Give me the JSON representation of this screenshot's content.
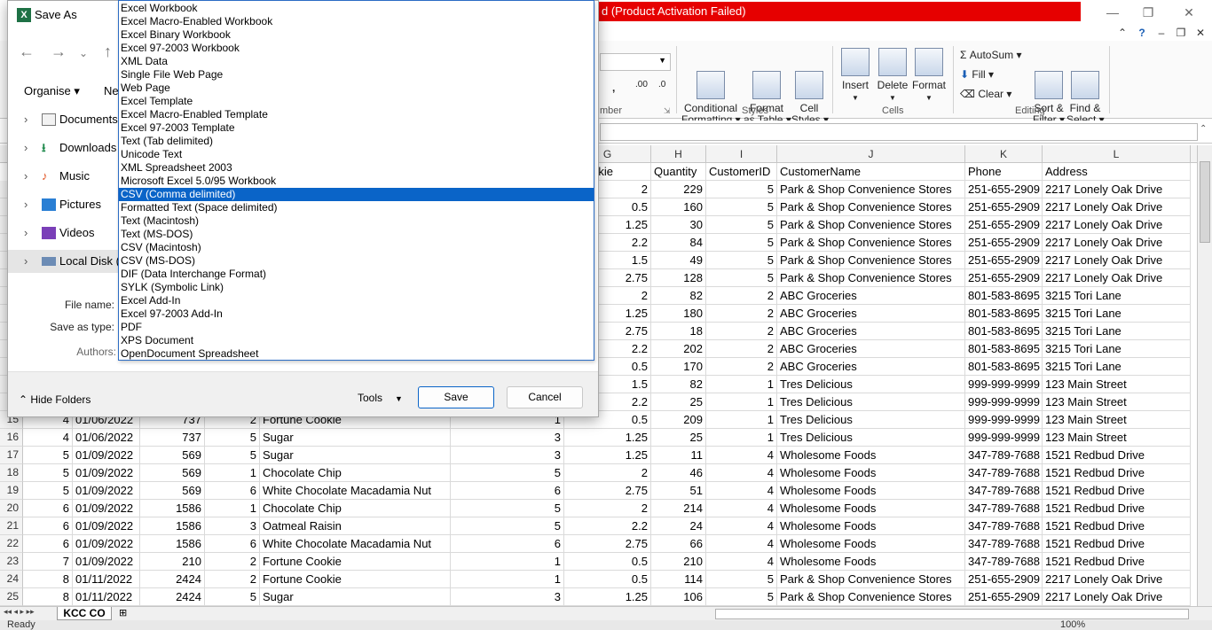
{
  "excel": {
    "activation_text": "d (Product Activation Failed)",
    "ribbon": {
      "conditional_formatting": "Conditional\nFormatting ▾",
      "format_as_table": "Format\nas Table ▾",
      "cell_styles": "Cell\nStyles ▾",
      "styles_label": "Styles",
      "insert": "Insert",
      "delete": "Delete",
      "format": "Format",
      "cells_label": "Cells",
      "autosum": "AutoSum ▾",
      "fill": "Fill ▾",
      "clear": "Clear ▾",
      "sort_filter": "Sort &\nFilter ▾",
      "find_select": "Find &\nSelect ▾",
      "editing_label": "Editing",
      "number_label": "mber",
      "number_dec_inc": ".00",
      "number_dec_dec": ".0"
    },
    "column_letters": [
      "G",
      "H",
      "I",
      "J",
      "K",
      "L"
    ],
    "header_row": {
      "g": "erCookie",
      "h": "Quantity",
      "i": "CustomerID",
      "j": "CustomerName",
      "k": "Phone",
      "l": "Address"
    },
    "rows": [
      {
        "n": "",
        "a": "",
        "b": "",
        "c": "",
        "d": "",
        "e": "",
        "f": "",
        "g": "2",
        "h": "229",
        "i": "5",
        "j": "Park & Shop Convenience Stores",
        "k": "251-655-2909",
        "l": "2217 Lonely Oak Drive"
      },
      {
        "n": "",
        "a": "",
        "b": "",
        "c": "",
        "d": "",
        "e": "",
        "f": "",
        "g": "0.5",
        "h": "160",
        "i": "5",
        "j": "Park & Shop Convenience Stores",
        "k": "251-655-2909",
        "l": "2217 Lonely Oak Drive"
      },
      {
        "n": "",
        "a": "",
        "b": "",
        "c": "",
        "d": "",
        "e": "",
        "f": "",
        "g": "1.25",
        "h": "30",
        "i": "5",
        "j": "Park & Shop Convenience Stores",
        "k": "251-655-2909",
        "l": "2217 Lonely Oak Drive"
      },
      {
        "n": "",
        "a": "",
        "b": "",
        "c": "",
        "d": "",
        "e": "",
        "f": "",
        "g": "2.2",
        "h": "84",
        "i": "5",
        "j": "Park & Shop Convenience Stores",
        "k": "251-655-2909",
        "l": "2217 Lonely Oak Drive"
      },
      {
        "n": "",
        "a": "",
        "b": "",
        "c": "",
        "d": "",
        "e": "",
        "f": "",
        "g": "1.5",
        "h": "49",
        "i": "5",
        "j": "Park & Shop Convenience Stores",
        "k": "251-655-2909",
        "l": "2217 Lonely Oak Drive"
      },
      {
        "n": "",
        "a": "",
        "b": "",
        "c": "",
        "d": "",
        "e": "",
        "f": "",
        "g": "2.75",
        "h": "128",
        "i": "5",
        "j": "Park & Shop Convenience Stores",
        "k": "251-655-2909",
        "l": "2217 Lonely Oak Drive"
      },
      {
        "n": "",
        "a": "",
        "b": "",
        "c": "",
        "d": "",
        "e": "",
        "f": "",
        "g": "2",
        "h": "82",
        "i": "2",
        "j": "ABC Groceries",
        "k": "801-583-8695",
        "l": "3215 Tori Lane"
      },
      {
        "n": "",
        "a": "",
        "b": "",
        "c": "",
        "d": "",
        "e": "",
        "f": "",
        "g": "1.25",
        "h": "180",
        "i": "2",
        "j": "ABC Groceries",
        "k": "801-583-8695",
        "l": "3215 Tori Lane"
      },
      {
        "n": "",
        "a": "",
        "b": "",
        "c": "",
        "d": "",
        "e": "",
        "f": "",
        "g": "2.75",
        "h": "18",
        "i": "2",
        "j": "ABC Groceries",
        "k": "801-583-8695",
        "l": "3215 Tori Lane"
      },
      {
        "n": "",
        "a": "",
        "b": "",
        "c": "",
        "d": "",
        "e": "",
        "f": "",
        "g": "2.2",
        "h": "202",
        "i": "2",
        "j": "ABC Groceries",
        "k": "801-583-8695",
        "l": "3215 Tori Lane"
      },
      {
        "n": "",
        "a": "",
        "b": "",
        "c": "",
        "d": "",
        "e": "",
        "f": "",
        "g": "0.5",
        "h": "170",
        "i": "2",
        "j": "ABC Groceries",
        "k": "801-583-8695",
        "l": "3215 Tori Lane"
      },
      {
        "n": "",
        "a": "",
        "b": "",
        "c": "",
        "d": "",
        "e": "",
        "f": "",
        "g": "1.5",
        "h": "82",
        "i": "1",
        "j": "Tres Delicious",
        "k": "999-999-9999",
        "l": "123 Main Street"
      },
      {
        "n": "",
        "a": "",
        "b": "",
        "c": "",
        "d": "",
        "e": "",
        "f": "",
        "g": "2.2",
        "h": "25",
        "i": "1",
        "j": "Tres Delicious",
        "k": "999-999-9999",
        "l": "123 Main Street"
      },
      {
        "n": "15",
        "a": "4",
        "b": "01/06/2022",
        "c": "737",
        "d": "2",
        "e": "Fortune Cookie",
        "f": "1",
        "g": "0.5",
        "h": "209",
        "i": "1",
        "j": "Tres Delicious",
        "k": "999-999-9999",
        "l": "123 Main Street"
      },
      {
        "n": "16",
        "a": "4",
        "b": "01/06/2022",
        "c": "737",
        "d": "5",
        "e": "Sugar",
        "f": "3",
        "g": "1.25",
        "h": "25",
        "i": "1",
        "j": "Tres Delicious",
        "k": "999-999-9999",
        "l": "123 Main Street"
      },
      {
        "n": "17",
        "a": "5",
        "b": "01/09/2022",
        "c": "569",
        "d": "5",
        "e": "Sugar",
        "f": "3",
        "g": "1.25",
        "h": "11",
        "i": "4",
        "j": "Wholesome Foods",
        "k": "347-789-7688",
        "l": "1521 Redbud Drive"
      },
      {
        "n": "18",
        "a": "5",
        "b": "01/09/2022",
        "c": "569",
        "d": "1",
        "e": "Chocolate Chip",
        "f": "5",
        "g": "2",
        "h": "46",
        "i": "4",
        "j": "Wholesome Foods",
        "k": "347-789-7688",
        "l": "1521 Redbud Drive"
      },
      {
        "n": "19",
        "a": "5",
        "b": "01/09/2022",
        "c": "569",
        "d": "6",
        "e": "White Chocolate Macadamia Nut",
        "f": "6",
        "g": "2.75",
        "h": "51",
        "i": "4",
        "j": "Wholesome Foods",
        "k": "347-789-7688",
        "l": "1521 Redbud Drive"
      },
      {
        "n": "20",
        "a": "6",
        "b": "01/09/2022",
        "c": "1586",
        "d": "1",
        "e": "Chocolate Chip",
        "f": "5",
        "g": "2",
        "h": "214",
        "i": "4",
        "j": "Wholesome Foods",
        "k": "347-789-7688",
        "l": "1521 Redbud Drive"
      },
      {
        "n": "21",
        "a": "6",
        "b": "01/09/2022",
        "c": "1586",
        "d": "3",
        "e": "Oatmeal Raisin",
        "f": "5",
        "g": "2.2",
        "h": "24",
        "i": "4",
        "j": "Wholesome Foods",
        "k": "347-789-7688",
        "l": "1521 Redbud Drive"
      },
      {
        "n": "22",
        "a": "6",
        "b": "01/09/2022",
        "c": "1586",
        "d": "6",
        "e": "White Chocolate Macadamia Nut",
        "f": "6",
        "g": "2.75",
        "h": "66",
        "i": "4",
        "j": "Wholesome Foods",
        "k": "347-789-7688",
        "l": "1521 Redbud Drive"
      },
      {
        "n": "23",
        "a": "7",
        "b": "01/09/2022",
        "c": "210",
        "d": "2",
        "e": "Fortune Cookie",
        "f": "1",
        "g": "0.5",
        "h": "210",
        "i": "4",
        "j": "Wholesome Foods",
        "k": "347-789-7688",
        "l": "1521 Redbud Drive"
      },
      {
        "n": "24",
        "a": "8",
        "b": "01/11/2022",
        "c": "2424",
        "d": "2",
        "e": "Fortune Cookie",
        "f": "1",
        "g": "0.5",
        "h": "114",
        "i": "5",
        "j": "Park & Shop Convenience Stores",
        "k": "251-655-2909",
        "l": "2217 Lonely Oak Drive"
      },
      {
        "n": "25",
        "a": "8",
        "b": "01/11/2022",
        "c": "2424",
        "d": "5",
        "e": "Sugar",
        "f": "3",
        "g": "1.25",
        "h": "106",
        "i": "5",
        "j": "Park & Shop Convenience Stores",
        "k": "251-655-2909",
        "l": "2217 Lonely Oak Drive"
      }
    ],
    "sheet_tab": "KCC CO",
    "status": "Ready",
    "zoom": "100%"
  },
  "dialog": {
    "title": "Save As",
    "organise": "Organise ▾",
    "new_folder": "Ne",
    "nav_items": [
      {
        "label": "Documents",
        "icon": "documents-icon"
      },
      {
        "label": "Downloads",
        "icon": "downloads-icon"
      },
      {
        "label": "Music",
        "icon": "music-icon"
      },
      {
        "label": "Pictures",
        "icon": "pictures-icon"
      },
      {
        "label": "Videos",
        "icon": "videos-icon"
      },
      {
        "label": "Local Disk (C",
        "icon": "local-disk-icon"
      }
    ],
    "file_name_label": "File name:",
    "save_as_type_label": "Save as type:",
    "authors_label": "Authors:",
    "hide_folders": "Hide Folders",
    "tools": "Tools",
    "save": "Save",
    "cancel": "Cancel"
  },
  "type_list": {
    "selected_index": 14,
    "options": [
      "Excel Workbook",
      "Excel Macro-Enabled Workbook",
      "Excel Binary Workbook",
      "Excel 97-2003 Workbook",
      "XML Data",
      "Single File Web Page",
      "Web Page",
      "Excel Template",
      "Excel Macro-Enabled Template",
      "Excel 97-2003 Template",
      "Text (Tab delimited)",
      "Unicode Text",
      "XML Spreadsheet 2003",
      "Microsoft Excel 5.0/95 Workbook",
      "CSV (Comma delimited)",
      "Formatted Text (Space delimited)",
      "Text (Macintosh)",
      "Text (MS-DOS)",
      "CSV (Macintosh)",
      "CSV (MS-DOS)",
      "DIF (Data Interchange Format)",
      "SYLK (Symbolic Link)",
      "Excel Add-In",
      "Excel 97-2003 Add-In",
      "PDF",
      "XPS Document",
      "OpenDocument Spreadsheet"
    ]
  },
  "colors": {
    "activation_bar": "#e60000",
    "selection": "#0a64c8"
  }
}
